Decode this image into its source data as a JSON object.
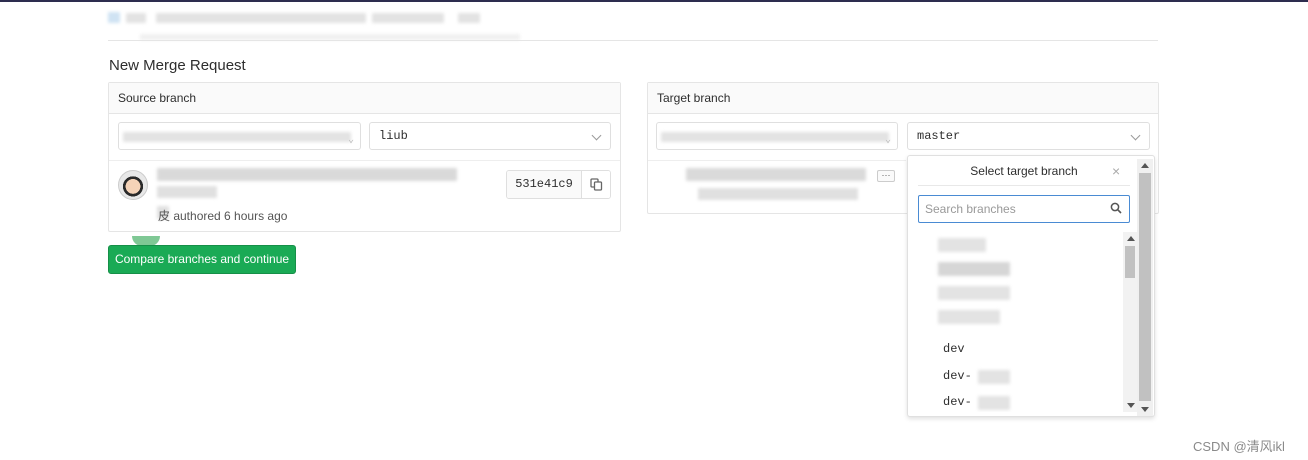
{
  "page": {
    "title": "New Merge Request",
    "watermark": "CSDN @清风ikl"
  },
  "source": {
    "heading": "Source branch",
    "branch_value": "liub",
    "commit_sha": "531e41c9",
    "commit_meta": "皮 authored 6 hours ago"
  },
  "target": {
    "heading": "Target branch",
    "branch_value": "master"
  },
  "compare_button_label": "Compare branches and continue",
  "dropdown": {
    "title": "Select target branch",
    "close_glyph": "×",
    "search_placeholder": "Search branches",
    "items": [
      "dev",
      "dev-",
      "dev-"
    ]
  },
  "colors": {
    "primary_green": "#1aaa55",
    "focus_blue": "#4a8bd3"
  },
  "icons": [
    "copy-icon",
    "search-icon",
    "close-icon",
    "chevron-down-icon",
    "ellipsis-icon"
  ]
}
